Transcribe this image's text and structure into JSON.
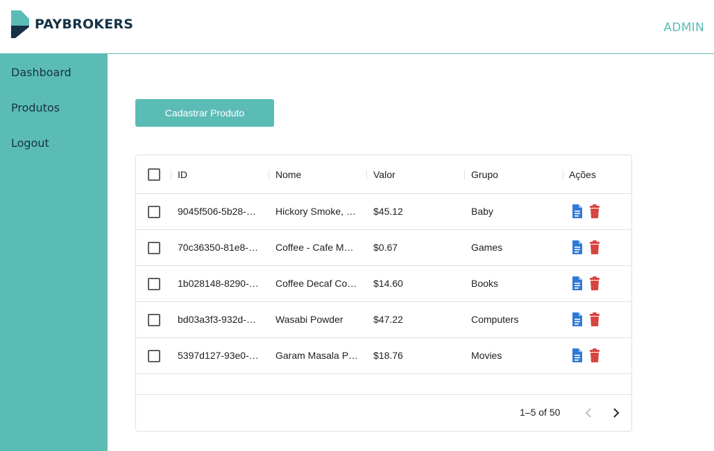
{
  "header": {
    "brand": "PAYBROKERS",
    "user_label": "ADMIN"
  },
  "sidebar": {
    "items": [
      {
        "label": "Dashboard"
      },
      {
        "label": "Produtos"
      },
      {
        "label": "Logout"
      }
    ]
  },
  "actions": {
    "create_product_label": "Cadastrar Produto"
  },
  "table": {
    "columns": [
      "ID",
      "Nome",
      "Valor",
      "Grupo",
      "Ações"
    ],
    "rows": [
      {
        "id": "9045f506-5b28-…",
        "name": "Hickory Smoke, …",
        "value": "$45.12",
        "group": "Baby"
      },
      {
        "id": "70c36350-81e8-…",
        "name": "Coffee - Cafe M…",
        "value": "$0.67",
        "group": "Games"
      },
      {
        "id": "1b028148-8290-…",
        "name": "Coffee Decaf Co…",
        "value": "$14.60",
        "group": "Books"
      },
      {
        "id": "bd03a3f3-932d-…",
        "name": "Wasabi Powder",
        "value": "$47.22",
        "group": "Computers"
      },
      {
        "id": "5397d127-93e0-…",
        "name": "Garam Masala P…",
        "value": "$18.76",
        "group": "Movies"
      }
    ],
    "pagination": "1–5 of 50"
  },
  "icons": {
    "edit": "document-icon",
    "delete": "trash-icon",
    "prev": "chevron-left-icon",
    "next": "chevron-right-icon"
  },
  "colors": {
    "accent": "#5bbcb6",
    "brand_dark": "#163246",
    "edit_blue": "#2f7ad6",
    "delete_red": "#d64541"
  }
}
